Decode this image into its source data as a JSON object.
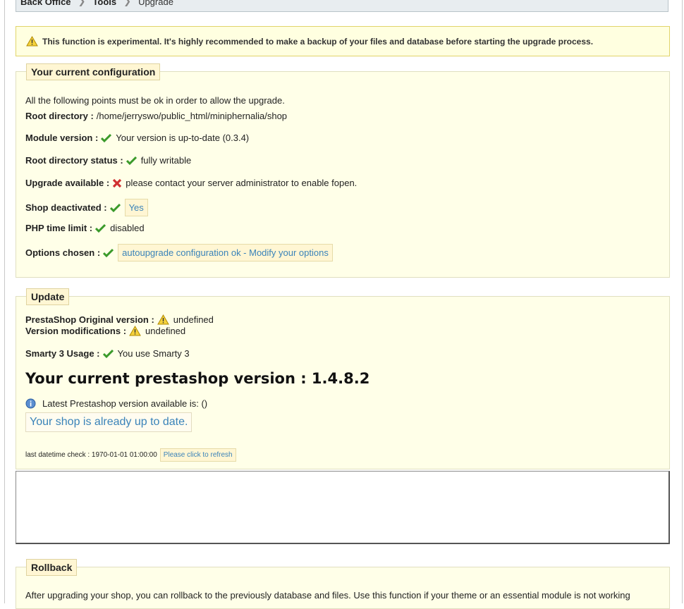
{
  "breadcrumb": {
    "items": [
      "Back Office",
      "Tools"
    ],
    "current": "Upgrade"
  },
  "warning": {
    "text": "This function is experimental. It's highly recommended to make a backup of your files and database before starting the upgrade process."
  },
  "config": {
    "legend": "Your current configuration",
    "intro": "All the following points must be ok in order to allow the upgrade.",
    "root_dir": {
      "label": "Root directory :",
      "value": "/home/jerryswo/public_html/miniphernalia/shop"
    },
    "module_version": {
      "label": "Module version :",
      "value": "Your version is up-to-date (0.3.4)"
    },
    "root_status": {
      "label": "Root directory status :",
      "value": "fully writable"
    },
    "upgrade_available": {
      "label": "Upgrade available :",
      "value": "please contact your server administrator to enable fopen."
    },
    "shop_deactivated": {
      "label": "Shop deactivated :",
      "value": "Yes"
    },
    "php_time_limit": {
      "label": "PHP time limit :",
      "value": "disabled"
    },
    "options_chosen": {
      "label": "Options chosen :",
      "value": "autoupgrade configuration ok - Modify your options"
    }
  },
  "update": {
    "legend": "Update",
    "original_version": {
      "label": "PrestaShop Original version :",
      "value": "undefined"
    },
    "version_mods": {
      "label": "Version modifications :",
      "value": "undefined"
    },
    "smarty": {
      "label": "Smarty 3 Usage :",
      "value": "You use Smarty 3"
    },
    "current_version": "Your current prestashop version : 1.4.8.2",
    "latest": "Latest Prestashop version available is: ()",
    "up_to_date": "Your shop is already up to date.",
    "last_check": "last datetime check : 1970-01-01 01:00:00",
    "refresh": "Please click to refresh"
  },
  "rollback": {
    "legend": "Rollback",
    "text": "After upgrading your shop, you can rollback to the previously database and files. Use this function if your theme or an essential module is not working"
  }
}
